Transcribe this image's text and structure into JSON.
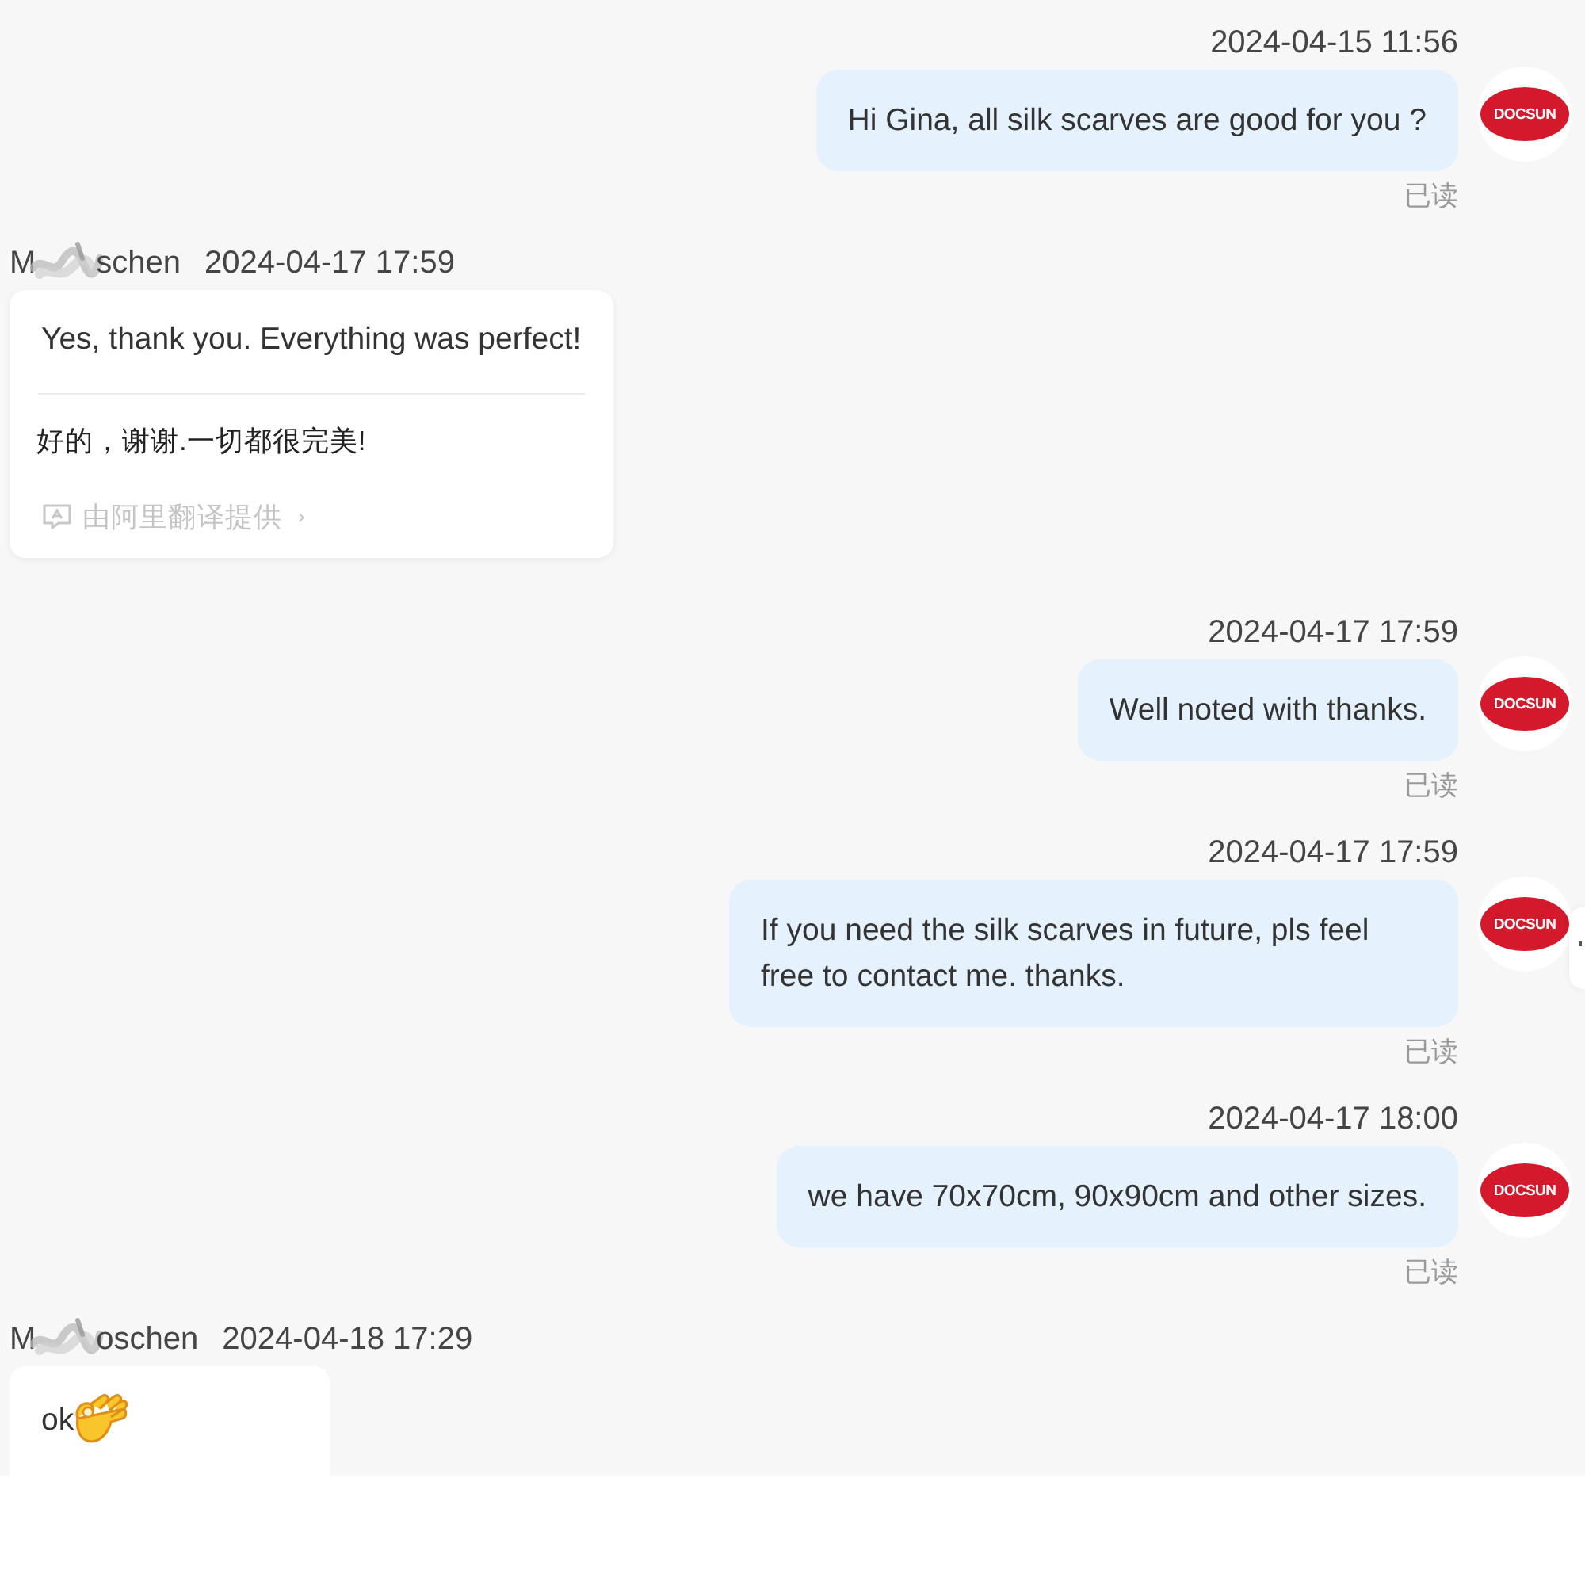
{
  "messages": [
    {
      "kind": "outgoing",
      "time": "2024-04-15 11:56",
      "text": "Hi Gina, all silk scarves are good for you ?",
      "avatar_logo": "DOCSUN",
      "status": "已读"
    },
    {
      "kind": "incoming",
      "sender_start": "M",
      "sender_end": "schen",
      "time": "2024-04-17 17:59",
      "text": "Yes, thank you. Everything was perfect!",
      "translation": "好的，谢谢.一切都很完美!",
      "translation_credit": "由阿里翻译提供",
      "credit_arrow": "›"
    },
    {
      "kind": "outgoing",
      "time": "2024-04-17 17:59",
      "text": "Well noted with thanks.",
      "avatar_logo": "DOCSUN",
      "status": "已读"
    },
    {
      "kind": "outgoing",
      "time": "2024-04-17 17:59",
      "text": "If you need the silk scarves in future, pls feel free to contact me. thanks.",
      "avatar_logo": "DOCSUN",
      "status": "已读"
    },
    {
      "kind": "outgoing",
      "time": "2024-04-17 18:00",
      "text": "we have 70x70cm, 90x90cm and other sizes.",
      "avatar_logo": "DOCSUN",
      "status": "已读"
    },
    {
      "kind": "incoming",
      "sender_start": "M",
      "sender_end": "oschen",
      "time": "2024-04-18 17:29",
      "text": "ok",
      "emoji": true
    }
  ]
}
